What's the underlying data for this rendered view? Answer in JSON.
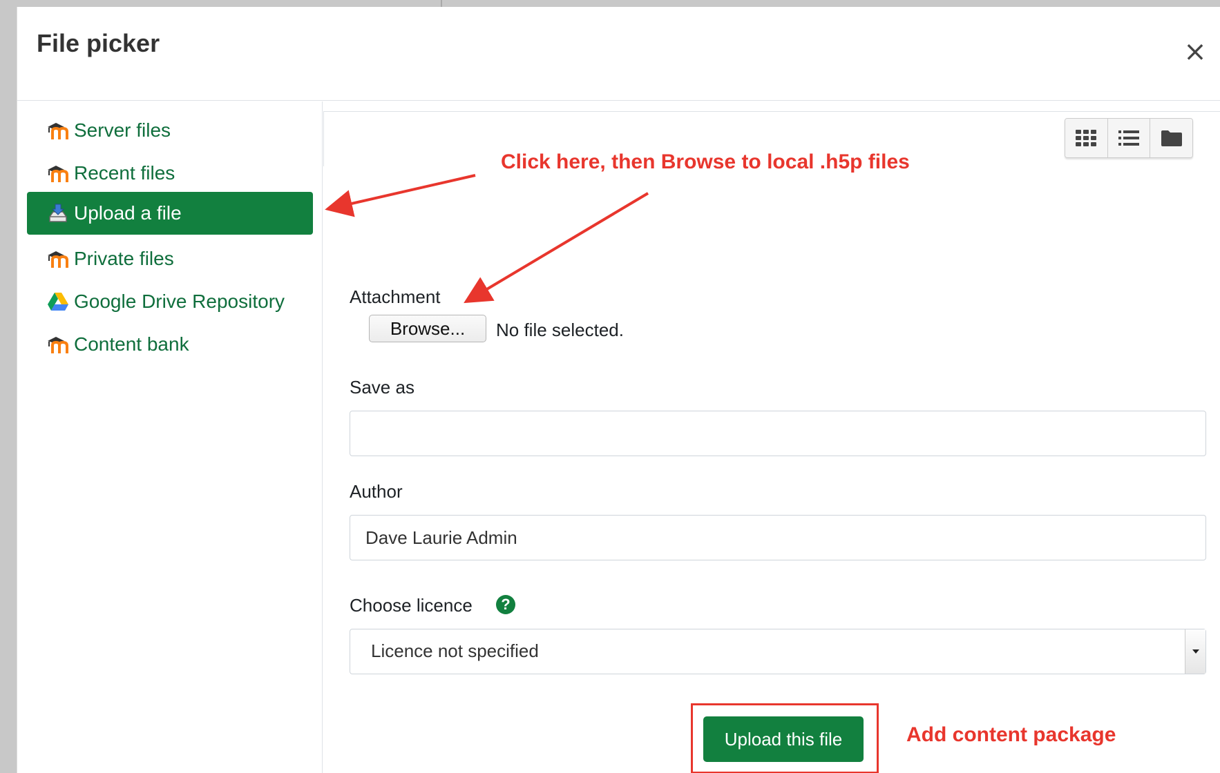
{
  "dialog": {
    "title": "File picker",
    "close_label": "×"
  },
  "sidebar": {
    "items": [
      {
        "label": "Server files",
        "icon": "moodle-icon",
        "active": false
      },
      {
        "label": "Recent files",
        "icon": "moodle-icon",
        "active": false
      },
      {
        "label": "Upload a file",
        "icon": "upload-icon",
        "active": true
      },
      {
        "label": "Private files",
        "icon": "moodle-icon",
        "active": false
      },
      {
        "label": "Google Drive Repository",
        "icon": "google-drive-icon",
        "active": false
      },
      {
        "label": "Content bank",
        "icon": "moodle-icon",
        "active": false
      }
    ]
  },
  "toolbar": {
    "view_buttons": [
      "grid-view-icon",
      "list-view-icon",
      "folder-view-icon"
    ]
  },
  "form": {
    "attachment_label": "Attachment",
    "browse_label": "Browse...",
    "no_file_text": "No file selected.",
    "save_as_label": "Save as",
    "save_as_value": "",
    "author_label": "Author",
    "author_value": "Dave Laurie Admin",
    "licence_label": "Choose licence",
    "licence_help": "?",
    "licence_value": "Licence not specified",
    "upload_label": "Upload this file"
  },
  "annotations": {
    "click_here": "Click here, then Browse to local .h5p files",
    "add_content": "Add content package"
  },
  "colors": {
    "primary_green": "#12803f",
    "link_green": "#0f6e3c",
    "annotation_red": "#e8362d",
    "moodle_orange": "#f98012"
  }
}
